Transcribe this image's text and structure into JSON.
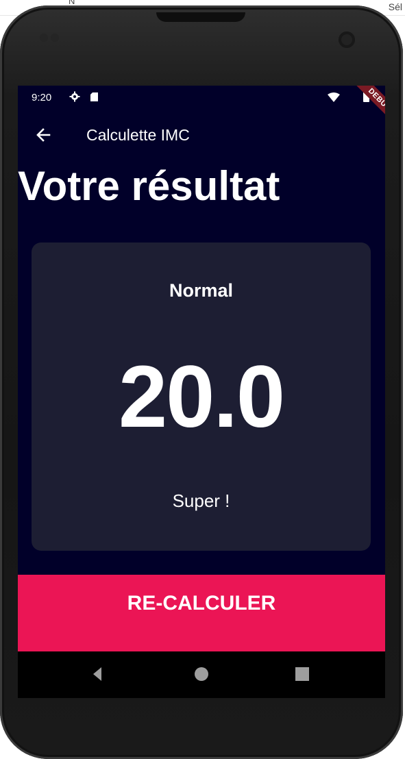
{
  "host": {
    "left_text": "N",
    "right_text": "Sél"
  },
  "status_bar": {
    "time": "9:20",
    "icons": [
      "gear-icon",
      "sd-card-icon",
      "wifi-icon",
      "battery-icon"
    ]
  },
  "debug_banner": "DEBUG",
  "app_bar": {
    "title": "Calculette IMC",
    "back_icon": "arrow-left-icon"
  },
  "result": {
    "heading": "Votre résultat",
    "category": "Normal",
    "value": "20.0",
    "message": "Super !"
  },
  "recalc_button": {
    "label": "RE-CALCULER"
  },
  "nav_bar": {
    "icons": [
      "back-triangle-icon",
      "home-circle-icon",
      "recent-square-icon"
    ]
  },
  "colors": {
    "background": "#010029",
    "card": "#1d1e33",
    "accent": "#eb1555",
    "text": "#ffffff"
  }
}
